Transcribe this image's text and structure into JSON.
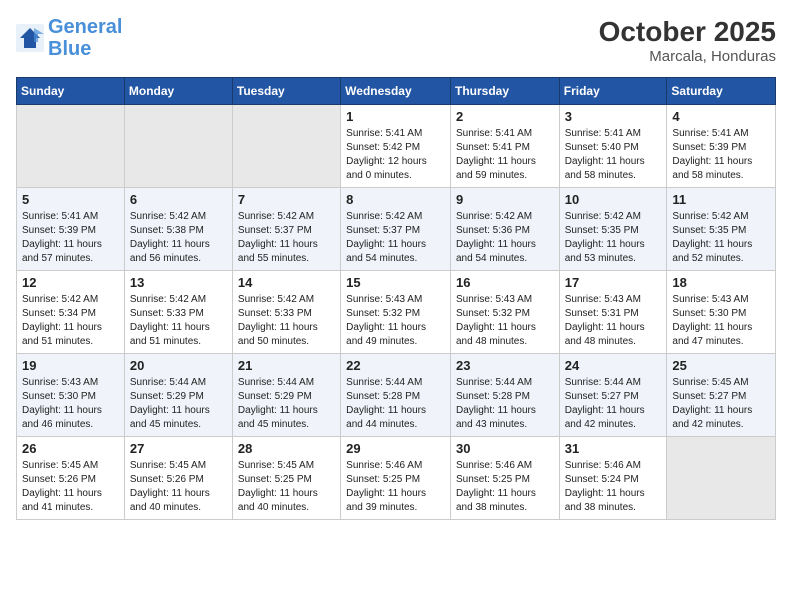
{
  "header": {
    "logo_line1": "General",
    "logo_line2": "Blue",
    "month": "October 2025",
    "location": "Marcala, Honduras"
  },
  "weekdays": [
    "Sunday",
    "Monday",
    "Tuesday",
    "Wednesday",
    "Thursday",
    "Friday",
    "Saturday"
  ],
  "weeks": [
    [
      {
        "day": "",
        "info": ""
      },
      {
        "day": "",
        "info": ""
      },
      {
        "day": "",
        "info": ""
      },
      {
        "day": "1",
        "info": "Sunrise: 5:41 AM\nSunset: 5:42 PM\nDaylight: 12 hours\nand 0 minutes."
      },
      {
        "day": "2",
        "info": "Sunrise: 5:41 AM\nSunset: 5:41 PM\nDaylight: 11 hours\nand 59 minutes."
      },
      {
        "day": "3",
        "info": "Sunrise: 5:41 AM\nSunset: 5:40 PM\nDaylight: 11 hours\nand 58 minutes."
      },
      {
        "day": "4",
        "info": "Sunrise: 5:41 AM\nSunset: 5:39 PM\nDaylight: 11 hours\nand 58 minutes."
      }
    ],
    [
      {
        "day": "5",
        "info": "Sunrise: 5:41 AM\nSunset: 5:39 PM\nDaylight: 11 hours\nand 57 minutes."
      },
      {
        "day": "6",
        "info": "Sunrise: 5:42 AM\nSunset: 5:38 PM\nDaylight: 11 hours\nand 56 minutes."
      },
      {
        "day": "7",
        "info": "Sunrise: 5:42 AM\nSunset: 5:37 PM\nDaylight: 11 hours\nand 55 minutes."
      },
      {
        "day": "8",
        "info": "Sunrise: 5:42 AM\nSunset: 5:37 PM\nDaylight: 11 hours\nand 54 minutes."
      },
      {
        "day": "9",
        "info": "Sunrise: 5:42 AM\nSunset: 5:36 PM\nDaylight: 11 hours\nand 54 minutes."
      },
      {
        "day": "10",
        "info": "Sunrise: 5:42 AM\nSunset: 5:35 PM\nDaylight: 11 hours\nand 53 minutes."
      },
      {
        "day": "11",
        "info": "Sunrise: 5:42 AM\nSunset: 5:35 PM\nDaylight: 11 hours\nand 52 minutes."
      }
    ],
    [
      {
        "day": "12",
        "info": "Sunrise: 5:42 AM\nSunset: 5:34 PM\nDaylight: 11 hours\nand 51 minutes."
      },
      {
        "day": "13",
        "info": "Sunrise: 5:42 AM\nSunset: 5:33 PM\nDaylight: 11 hours\nand 51 minutes."
      },
      {
        "day": "14",
        "info": "Sunrise: 5:42 AM\nSunset: 5:33 PM\nDaylight: 11 hours\nand 50 minutes."
      },
      {
        "day": "15",
        "info": "Sunrise: 5:43 AM\nSunset: 5:32 PM\nDaylight: 11 hours\nand 49 minutes."
      },
      {
        "day": "16",
        "info": "Sunrise: 5:43 AM\nSunset: 5:32 PM\nDaylight: 11 hours\nand 48 minutes."
      },
      {
        "day": "17",
        "info": "Sunrise: 5:43 AM\nSunset: 5:31 PM\nDaylight: 11 hours\nand 48 minutes."
      },
      {
        "day": "18",
        "info": "Sunrise: 5:43 AM\nSunset: 5:30 PM\nDaylight: 11 hours\nand 47 minutes."
      }
    ],
    [
      {
        "day": "19",
        "info": "Sunrise: 5:43 AM\nSunset: 5:30 PM\nDaylight: 11 hours\nand 46 minutes."
      },
      {
        "day": "20",
        "info": "Sunrise: 5:44 AM\nSunset: 5:29 PM\nDaylight: 11 hours\nand 45 minutes."
      },
      {
        "day": "21",
        "info": "Sunrise: 5:44 AM\nSunset: 5:29 PM\nDaylight: 11 hours\nand 45 minutes."
      },
      {
        "day": "22",
        "info": "Sunrise: 5:44 AM\nSunset: 5:28 PM\nDaylight: 11 hours\nand 44 minutes."
      },
      {
        "day": "23",
        "info": "Sunrise: 5:44 AM\nSunset: 5:28 PM\nDaylight: 11 hours\nand 43 minutes."
      },
      {
        "day": "24",
        "info": "Sunrise: 5:44 AM\nSunset: 5:27 PM\nDaylight: 11 hours\nand 42 minutes."
      },
      {
        "day": "25",
        "info": "Sunrise: 5:45 AM\nSunset: 5:27 PM\nDaylight: 11 hours\nand 42 minutes."
      }
    ],
    [
      {
        "day": "26",
        "info": "Sunrise: 5:45 AM\nSunset: 5:26 PM\nDaylight: 11 hours\nand 41 minutes."
      },
      {
        "day": "27",
        "info": "Sunrise: 5:45 AM\nSunset: 5:26 PM\nDaylight: 11 hours\nand 40 minutes."
      },
      {
        "day": "28",
        "info": "Sunrise: 5:45 AM\nSunset: 5:25 PM\nDaylight: 11 hours\nand 40 minutes."
      },
      {
        "day": "29",
        "info": "Sunrise: 5:46 AM\nSunset: 5:25 PM\nDaylight: 11 hours\nand 39 minutes."
      },
      {
        "day": "30",
        "info": "Sunrise: 5:46 AM\nSunset: 5:25 PM\nDaylight: 11 hours\nand 38 minutes."
      },
      {
        "day": "31",
        "info": "Sunrise: 5:46 AM\nSunset: 5:24 PM\nDaylight: 11 hours\nand 38 minutes."
      },
      {
        "day": "",
        "info": ""
      }
    ]
  ]
}
